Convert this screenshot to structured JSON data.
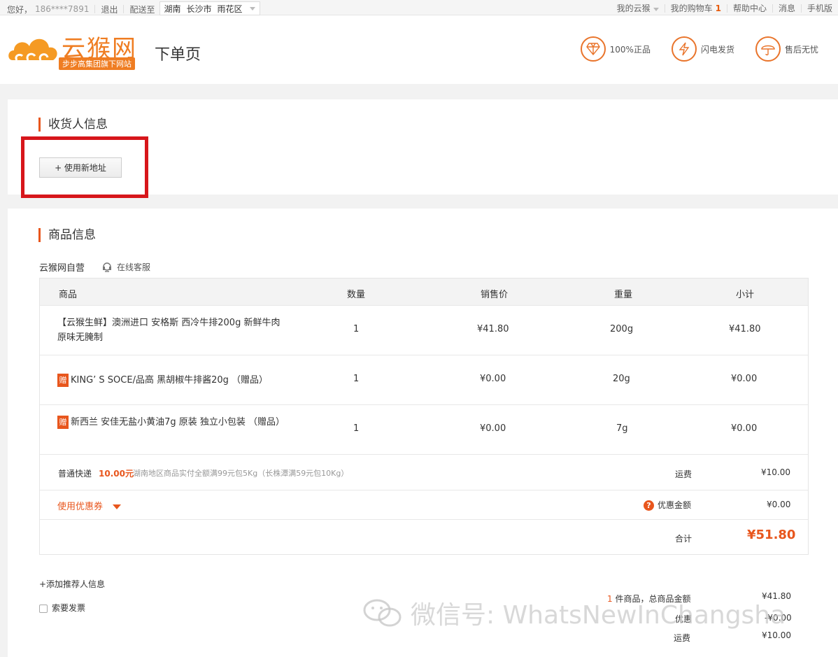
{
  "topbar": {
    "greeting": "您好，",
    "phone": "186****7891",
    "logout": "退出",
    "deliver_to": "配送至",
    "region": [
      "湖南",
      "长沙市",
      "雨花区"
    ],
    "my_account": "我的云猴",
    "cart": "我的购物车",
    "cart_count": "1",
    "help": "帮助中心",
    "messages": "消息",
    "mobile": "手机版"
  },
  "header": {
    "logo_text": "云猴网",
    "logo_sub": "步步高集团旗下网站",
    "page_title": "下单页",
    "badges": [
      {
        "label": "100%正品",
        "icon": "diamond-icon"
      },
      {
        "label": "闪电发货",
        "icon": "lightning-icon"
      },
      {
        "label": "售后无忧",
        "icon": "umbrella-icon"
      }
    ]
  },
  "receiver": {
    "title": "收货人信息",
    "new_address": "+ 使用新地址"
  },
  "goods": {
    "title": "商品信息",
    "shop_name": "云猴网自营",
    "customer_service": "在线客服",
    "columns": [
      "商品",
      "数量",
      "销售价",
      "重量",
      "小计"
    ],
    "rows": [
      {
        "gift": false,
        "name": "【云猴生鲜】澳洲进口 安格斯 西冷牛排200g 新鲜牛肉 原味无腌制",
        "qty": "1",
        "price": "¥41.80",
        "weight": "200g",
        "subtotal": "¥41.80"
      },
      {
        "gift": true,
        "gift_label": "赠",
        "name": "KING’ S SOCE/品高 黑胡椒牛排酱20g （赠品）",
        "qty": "1",
        "price": "¥0.00",
        "weight": "20g",
        "subtotal": "¥0.00"
      },
      {
        "gift": true,
        "gift_label": "赠",
        "name": "新西兰 安佳无盐小黄油7g 原装 独立小包装 （赠品）",
        "qty": "1",
        "price": "¥0.00",
        "weight": "7g",
        "subtotal": "¥0.00"
      }
    ],
    "shipping": {
      "method": "普通快递",
      "fee": "10.00元",
      "note": "湖南地区商品实付全额满99元包5Kg（长株潭满59元包10Kg）",
      "label": "运费",
      "amount": "¥10.00"
    },
    "coupon": {
      "label": "使用优惠券",
      "discount_label": "优惠金额",
      "discount_amount": "¥0.00"
    },
    "total": {
      "label": "合计",
      "amount": "¥51.80"
    }
  },
  "footer": {
    "add_referrer": "+添加推荐人信息",
    "invoice": "索要发票",
    "item_count": "1",
    "items_total_label": "件商品，总商品金额",
    "items_total": "¥41.80",
    "discount_label": "优惠",
    "discount": "-¥0.00",
    "freight_label": "运费",
    "freight": "¥10.00"
  },
  "watermark": "微信号: WhatsNewInChangsha",
  "colors": {
    "accent": "#e8561d",
    "logo": "#ef7d22",
    "highlight": "#d7161b"
  }
}
